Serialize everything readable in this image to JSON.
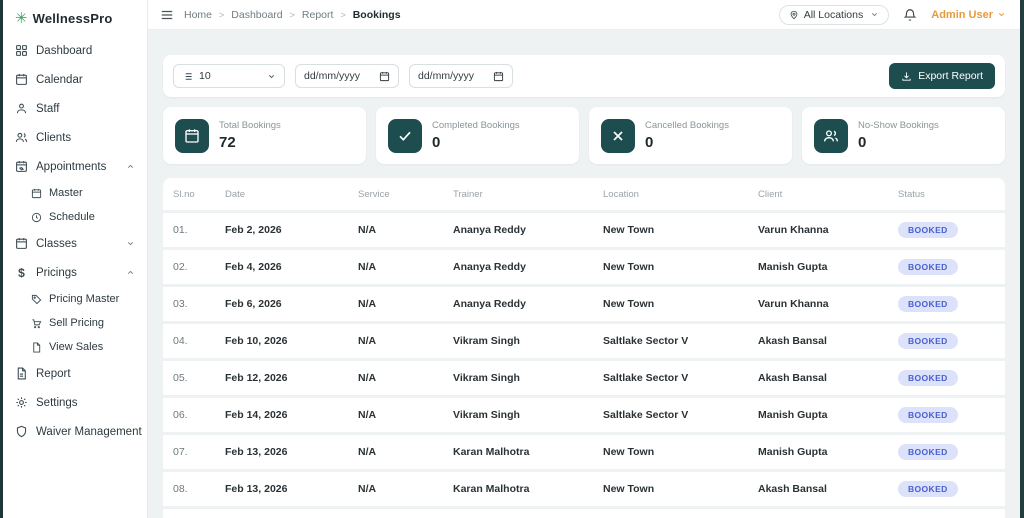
{
  "brand": {
    "name": "WellnessPro"
  },
  "sidebar": {
    "items": [
      {
        "label": "Dashboard"
      },
      {
        "label": "Calendar"
      },
      {
        "label": "Staff"
      },
      {
        "label": "Clients"
      },
      {
        "label": "Appointments",
        "children": [
          {
            "label": "Master"
          },
          {
            "label": "Schedule"
          }
        ]
      },
      {
        "label": "Classes"
      },
      {
        "label": "Pricings",
        "children": [
          {
            "label": "Pricing Master"
          },
          {
            "label": "Sell Pricing"
          },
          {
            "label": "View Sales"
          }
        ]
      },
      {
        "label": "Report"
      },
      {
        "label": "Settings"
      },
      {
        "label": "Waiver Management"
      }
    ]
  },
  "topbar": {
    "breadcrumb": {
      "home": "Home",
      "dashboard": "Dashboard",
      "report": "Report",
      "current": "Bookings"
    },
    "location": "All Locations",
    "user": "Admin User"
  },
  "filters": {
    "page_size": "10",
    "date_from": "dd/mm/yyyy",
    "date_to": "dd/mm/yyyy",
    "export": "Export Report"
  },
  "stats": [
    {
      "label": "Total Bookings",
      "value": "72"
    },
    {
      "label": "Completed Bookings",
      "value": "0"
    },
    {
      "label": "Cancelled Bookings",
      "value": "0"
    },
    {
      "label": "No-Show Bookings",
      "value": "0"
    }
  ],
  "table": {
    "columns": [
      "Sl.no",
      "Date",
      "Service",
      "Trainer",
      "Location",
      "Client",
      "Status"
    ],
    "rows": [
      [
        "01.",
        "Feb 2, 2026",
        "N/A",
        "Ananya Reddy",
        "New Town",
        "Varun Khanna",
        "BOOKED"
      ],
      [
        "02.",
        "Feb 4, 2026",
        "N/A",
        "Ananya Reddy",
        "New Town",
        "Manish Gupta",
        "BOOKED"
      ],
      [
        "03.",
        "Feb 6, 2026",
        "N/A",
        "Ananya Reddy",
        "New Town",
        "Varun Khanna",
        "BOOKED"
      ],
      [
        "04.",
        "Feb 10, 2026",
        "N/A",
        "Vikram Singh",
        "Saltlake Sector V",
        "Akash Bansal",
        "BOOKED"
      ],
      [
        "05.",
        "Feb 12, 2026",
        "N/A",
        "Vikram Singh",
        "Saltlake Sector V",
        "Akash Bansal",
        "BOOKED"
      ],
      [
        "06.",
        "Feb 14, 2026",
        "N/A",
        "Vikram Singh",
        "Saltlake Sector V",
        "Manish Gupta",
        "BOOKED"
      ],
      [
        "07.",
        "Feb 13, 2026",
        "N/A",
        "Karan Malhotra",
        "New Town",
        "Manish Gupta",
        "BOOKED"
      ],
      [
        "08.",
        "Feb 13, 2026",
        "N/A",
        "Karan Malhotra",
        "New Town",
        "Akash Bansal",
        "BOOKED"
      ]
    ]
  },
  "colors": {
    "accent": "#1d4d4f",
    "user_accent": "#e79a3d",
    "badge_bg": "#dbe2f9",
    "badge_text": "#4a5ed0",
    "logo_green": "#3f9e63"
  }
}
